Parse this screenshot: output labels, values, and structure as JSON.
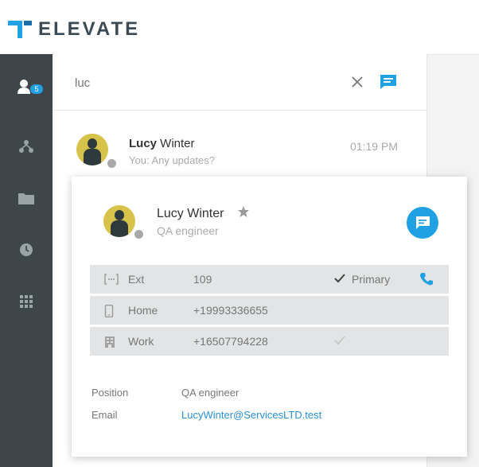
{
  "app": {
    "logo_text": "ELEVATE",
    "accent_color": "#1fa1e3"
  },
  "sidebar": {
    "items": [
      {
        "name": "contacts",
        "icon": "user-icon",
        "badge": "5",
        "active": true
      },
      {
        "name": "team",
        "icon": "org-chart-icon"
      },
      {
        "name": "files",
        "icon": "folder-icon"
      },
      {
        "name": "history",
        "icon": "clock-icon"
      },
      {
        "name": "dialpad",
        "icon": "grid-icon"
      }
    ]
  },
  "search": {
    "value": "luc",
    "clear_icon": "close-icon",
    "chat_icon": "chat-icon"
  },
  "conversation": {
    "name_match": "Lucy",
    "name_rest": " Winter",
    "preview": "You: Any updates?",
    "time": "01:19 PM",
    "presence_color": "#a9a9a9"
  },
  "contact_card": {
    "name": "Lucy Winter",
    "role": "QA engineer",
    "favorite_icon": "star-icon",
    "chat_icon": "chat-icon",
    "phones": [
      {
        "icon": "ext-icon",
        "label": "Ext",
        "number": "109",
        "checked": true,
        "primary_label": "Primary",
        "call_icon": "phone-icon"
      },
      {
        "icon": "mobile-icon",
        "label": "Home",
        "number": "+19993336655",
        "checked": false
      },
      {
        "icon": "building-icon",
        "label": "Work",
        "number": "+16507794228",
        "checked": true
      }
    ],
    "details": {
      "position_label": "Position",
      "position_value": "QA engineer",
      "email_label": "Email",
      "email_value": "LucyWinter@ServicesLTD.test"
    }
  }
}
